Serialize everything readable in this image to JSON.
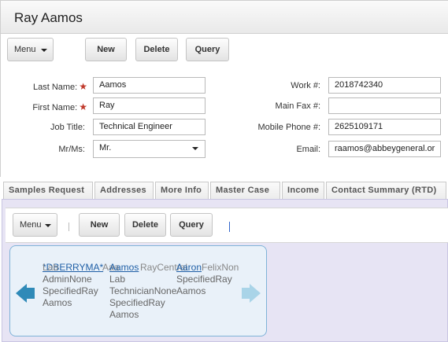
{
  "window": {
    "title": "Ray Aamos"
  },
  "toolbar": {
    "menu_label": "Menu",
    "new_label": "New",
    "delete_label": "Delete",
    "query_label": "Query"
  },
  "form": {
    "last_name": {
      "label": "Last Name:",
      "value": "Aamos"
    },
    "first_name": {
      "label": "First Name:",
      "value": "Ray"
    },
    "job_title": {
      "label": "Job Title:",
      "value": "Technical Engineer"
    },
    "mr_ms": {
      "label": "Mr/Ms:",
      "value": "Mr."
    },
    "work": {
      "label": "Work #:",
      "value": "2018742340"
    },
    "main_fax": {
      "label": "Main Fax #:",
      "value": ""
    },
    "mobile": {
      "label": "Mobile Phone #:",
      "value": "2625109171"
    },
    "email": {
      "label": "Email:",
      "value": "raamos@abbeygeneral.or"
    },
    "required_marker": "★"
  },
  "tabs": [
    "Samples Request",
    "Addresses",
    "More Info",
    "Master Case",
    "Income",
    "Contact Summary (RTD)"
  ],
  "sub_toolbar": {
    "menu_label": "Menu",
    "new_label": "New",
    "delete_label": "Delete",
    "query_label": "Query"
  },
  "card": {
    "col1": {
      "link": "*DBERRYMA*",
      "overlap": "Aaa",
      "lines": [
        "Lab",
        "AdminNone",
        "SpecifiedRay",
        "Aamos"
      ]
    },
    "col2": {
      "link": "Aamos",
      "overlap": "RayCentral",
      "lines": [
        "Lab",
        "TechnicianNone",
        "SpecifiedRay",
        "Aamos"
      ]
    },
    "col3": {
      "link": "Aaron",
      "overlap": "FelixNone",
      "lines": [
        "SpecifiedRay",
        "Aamos"
      ]
    }
  },
  "colors": {
    "required": "#c0392b",
    "link": "#1f5fa6",
    "sub_bg": "#e7e4f4",
    "card_border": "#7fb3d8"
  }
}
